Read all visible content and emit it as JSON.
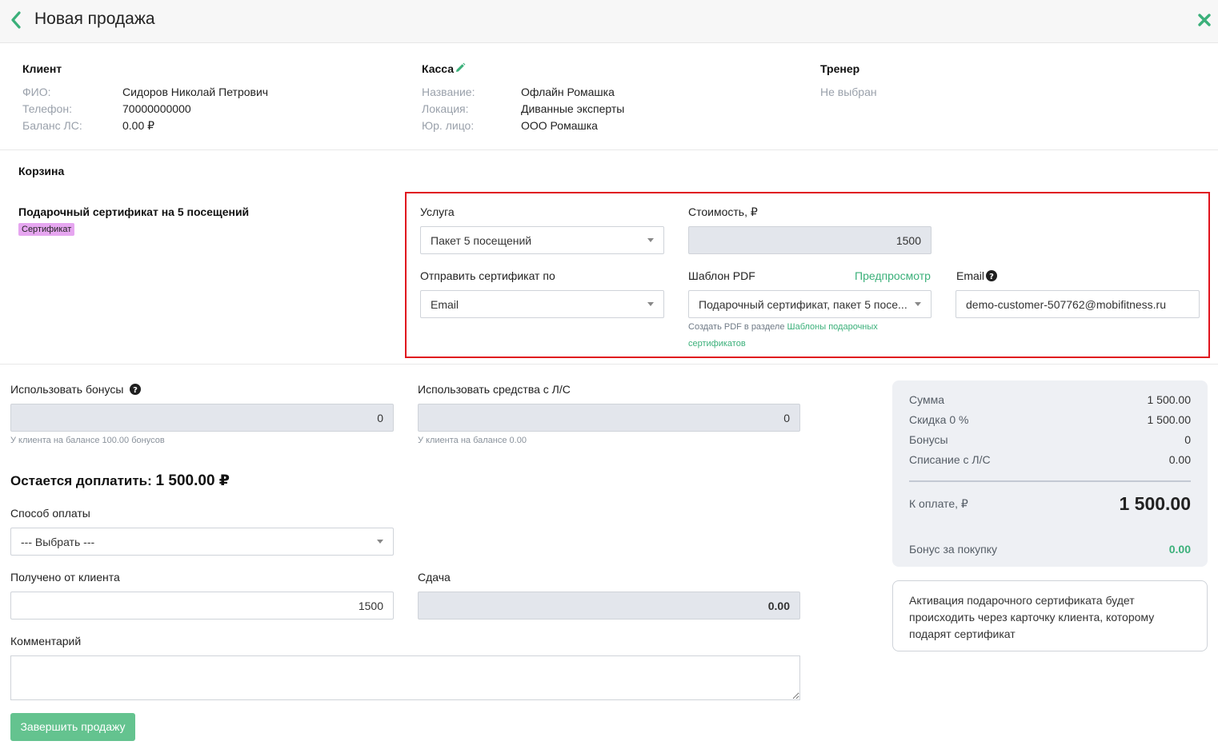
{
  "header": {
    "title": "Новая продажа"
  },
  "client": {
    "section_title": "Клиент",
    "fio_label": "ФИО:",
    "fio_value": "Сидоров Николай Петрович",
    "phone_label": "Телефон:",
    "phone_value": "70000000000",
    "balance_label": "Баланс ЛС:",
    "balance_value": "0.00 ₽"
  },
  "cashbox": {
    "section_title": "Касса",
    "name_label": "Название:",
    "name_value": "Офлайн Ромашка",
    "location_label": "Локация:",
    "location_value": "Диванные эксперты",
    "legal_label": "Юр. лицо:",
    "legal_value": "ООО Ромашка"
  },
  "trainer": {
    "section_title": "Тренер",
    "value": "Не выбран"
  },
  "cart": {
    "section_title": "Корзина",
    "item_title": "Подарочный сертификат на 5 посещений",
    "item_badge": "Сертификат",
    "service_label": "Услуга",
    "service_value": "Пакет 5 посещений",
    "cost_label": "Стоимость, ₽",
    "cost_value": "1500",
    "send_label": "Отправить сертификат по",
    "send_value": "Email",
    "pdf_label": "Шаблон PDF",
    "preview_link": "Предпросмотр",
    "pdf_value": "Подарочный сертификат, пакет 5 посе...",
    "pdf_hint_prefix": "Создать PDF в разделе",
    "pdf_hint_link": "Шаблоны подарочных сертификатов",
    "email_label": "Email",
    "email_value": "demo-customer-507762@mobifitness.ru"
  },
  "payment": {
    "bonus_label": "Использовать бонусы",
    "bonus_value": "0",
    "bonus_hint": "У клиента на балансе 100.00 бонусов",
    "ls_label": "Использовать средства с Л/С",
    "ls_value": "0",
    "ls_hint": "У клиента на балансе 0.00",
    "remain_label": "Остается доплатить:",
    "remain_value": "1 500.00 ₽",
    "method_label": "Способ оплаты",
    "method_value": "--- Выбрать ---",
    "received_label": "Получено от клиента",
    "received_value": "1500",
    "change_label": "Сдача",
    "change_value": "0.00",
    "comment_label": "Комментарий",
    "finish_button": "Завершить продажу"
  },
  "summary": {
    "sum_label": "Сумма",
    "sum_value": "1 500.00",
    "discount_label": "Скидка 0 %",
    "discount_value": "1 500.00",
    "bonus_label": "Бонусы",
    "bonus_value": "0",
    "ls_label": "Списание с Л/С",
    "ls_value": "0.00",
    "pay_label": "К оплате, ₽",
    "pay_value": "1 500.00",
    "purchase_bonus_label": "Бонус за покупку",
    "purchase_bonus_value": "0.00"
  },
  "notice": {
    "text": "Активация подарочного сертификата будет происходить через карточку клиента, которому подарят сертификат"
  },
  "colors": {
    "accent": "#3bb07a",
    "highlight_border": "#e0141e",
    "badge": "#e6a6f0",
    "finish_button": "#64c38f"
  },
  "icons": {
    "back": "chevron-left-icon",
    "close": "close-icon",
    "edit": "pencil-icon",
    "help": "question-circle-icon",
    "dropdown": "caret-down-icon"
  }
}
